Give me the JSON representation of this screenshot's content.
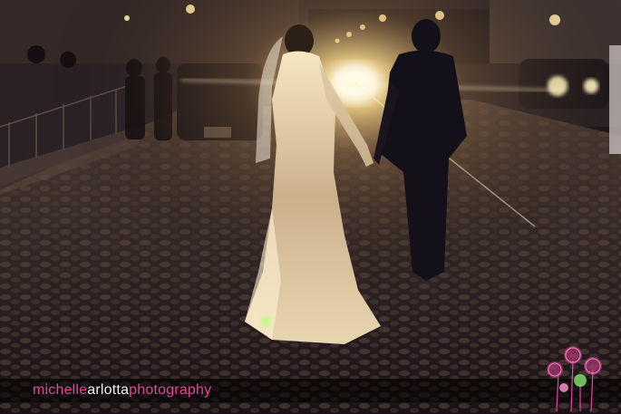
{
  "photo": {
    "subject": "bride-and-groom-cobblestone-night",
    "colors": {
      "accent": "#e2479a",
      "light": "#fff3c8",
      "cobble": "#3a2a24"
    }
  },
  "watermark": {
    "part1": "michelle",
    "part2": "arlotta",
    "part3": "photography"
  },
  "icons": [
    "flower-logo-icon"
  ]
}
